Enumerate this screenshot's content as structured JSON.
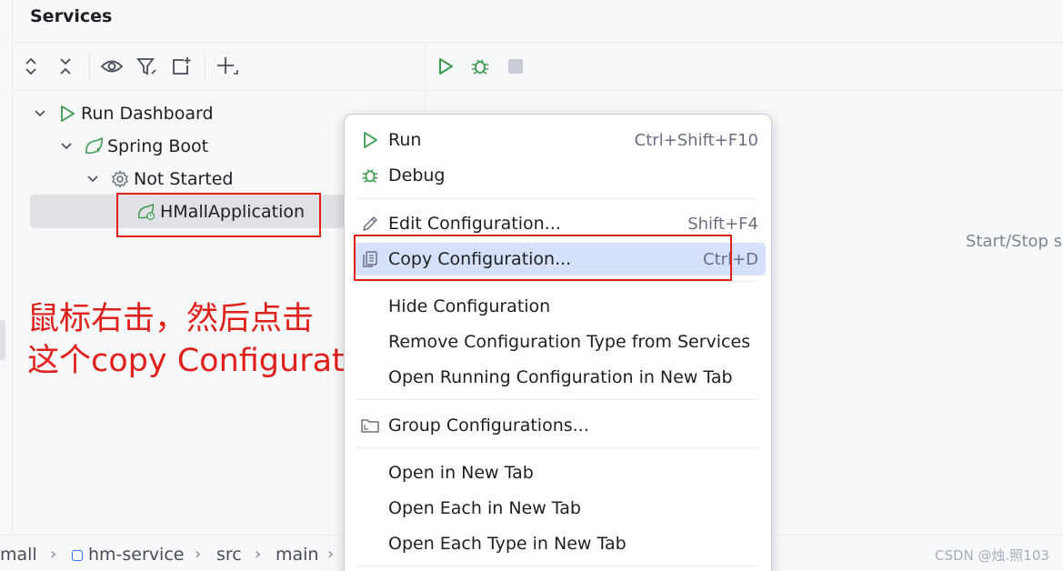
{
  "panel": {
    "title": "Services"
  },
  "toolbar": {
    "buttons": [
      "expand-all-icon",
      "collapse-all-icon",
      "eye-icon",
      "filter-icon",
      "new-tab-icon",
      "add-icon"
    ]
  },
  "run_toolbar": {
    "buttons": [
      "run-icon",
      "debug-icon",
      "stop-icon"
    ]
  },
  "tree": {
    "items": [
      {
        "label": "Run Dashboard",
        "icon": "run-icon"
      },
      {
        "label": "Spring Boot",
        "icon": "spring-boot-icon"
      },
      {
        "label": "Not Started",
        "icon": "gear-icon"
      },
      {
        "label": "HMallApplication",
        "icon": "spring-boot-icon"
      }
    ]
  },
  "annotation": {
    "line1": "鼠标右击，然后点击",
    "line2": "这个copy Configuration"
  },
  "right_panel": {
    "hint": "Start/Stop s"
  },
  "context_menu": {
    "items": [
      {
        "label": "Run",
        "shortcut": "Ctrl+Shift+F10",
        "icon": "run-icon"
      },
      {
        "label": "Debug",
        "shortcut": "",
        "icon": "debug-icon"
      },
      {
        "label": "Edit Configuration...",
        "shortcut": "Shift+F4",
        "icon": "pencil-icon"
      },
      {
        "label": "Copy Configuration...",
        "shortcut": "Ctrl+D",
        "icon": "copy-icon"
      },
      {
        "label": "Hide Configuration",
        "shortcut": ""
      },
      {
        "label": "Remove Configuration Type from Services",
        "shortcut": ""
      },
      {
        "label": "Open Running Configuration in New Tab",
        "shortcut": ""
      },
      {
        "label": "Group Configurations...",
        "shortcut": "",
        "icon": "folder-icon"
      },
      {
        "label": "Open in New Tab",
        "shortcut": ""
      },
      {
        "label": "Open Each in New Tab",
        "shortcut": ""
      },
      {
        "label": "Open Each Type in New Tab",
        "shortcut": ""
      }
    ]
  },
  "breadcrumb": [
    "mall",
    "hm-service",
    "src",
    "main"
  ],
  "watermark": "CSDN @烛.照103",
  "colors": {
    "accent_green": "#3d9a50",
    "annotation_red": "#e0201b",
    "highlight": "#d5e1fb"
  }
}
